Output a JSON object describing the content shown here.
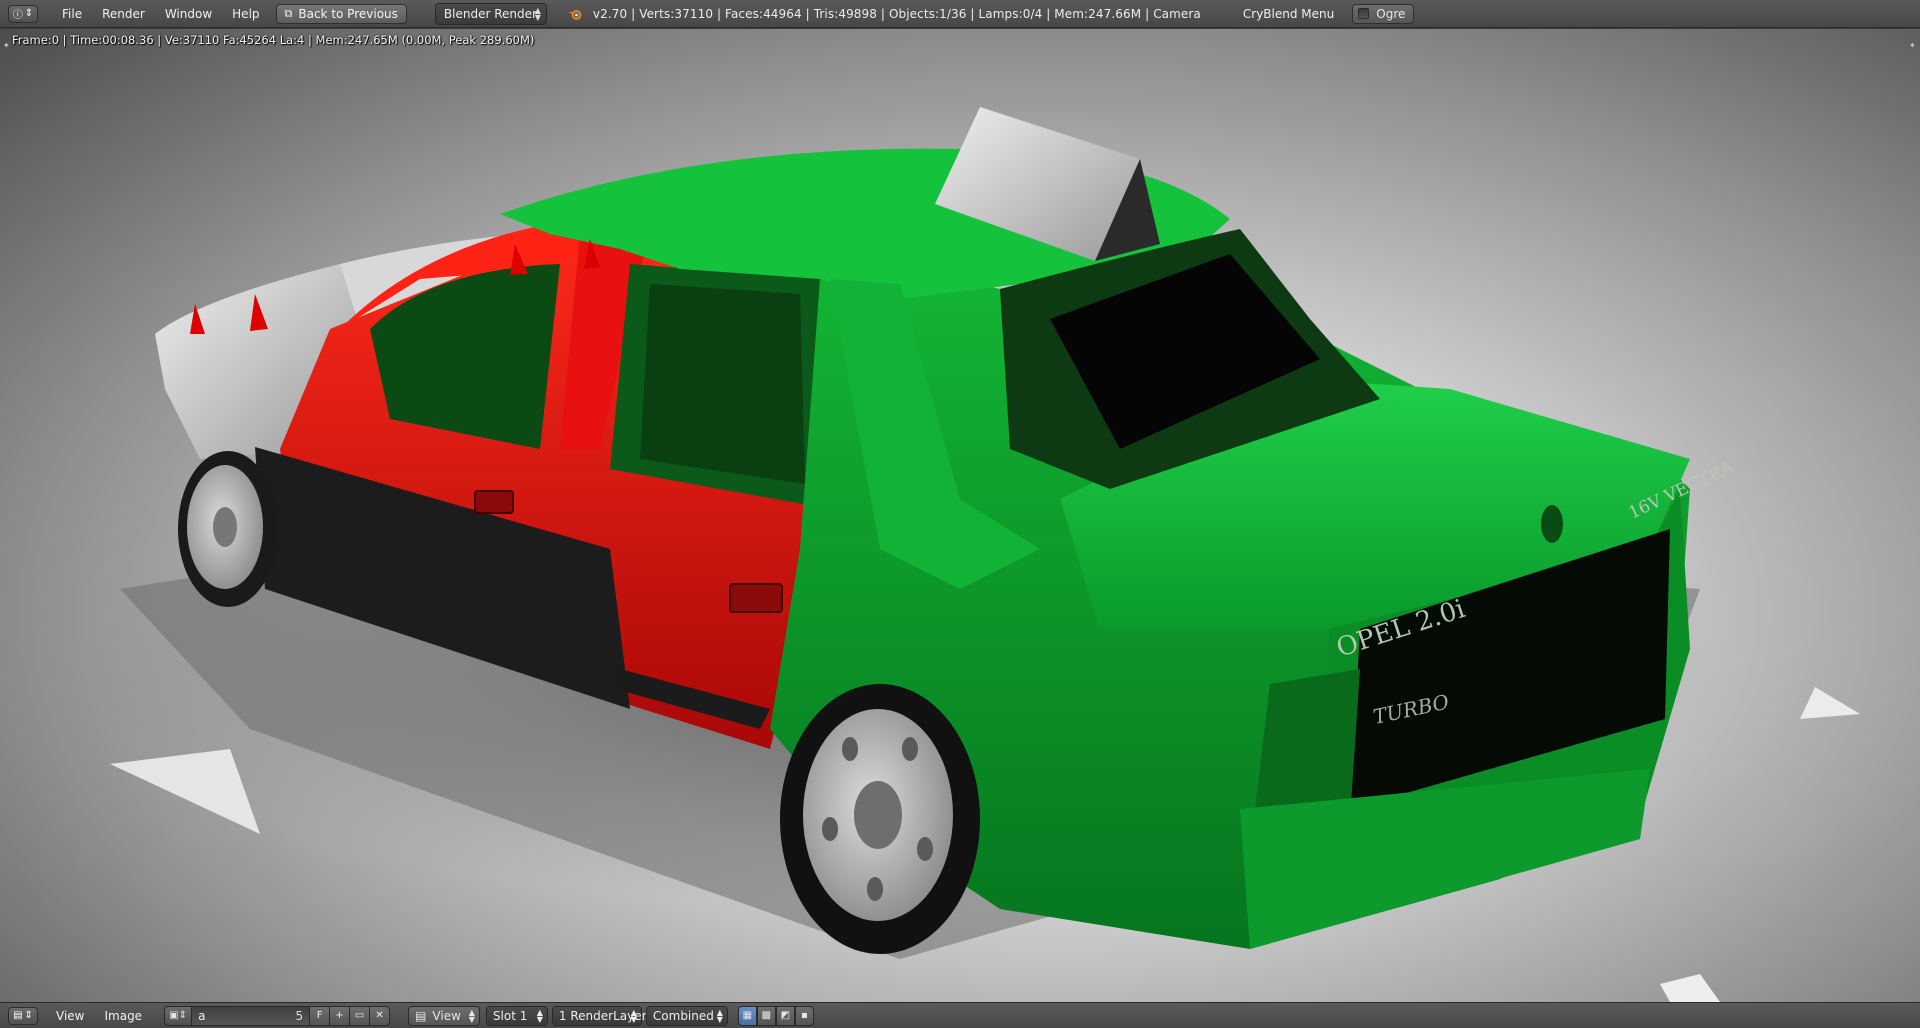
{
  "topbar": {
    "editor_icon": "info-icon",
    "menus": [
      "File",
      "Render",
      "Window",
      "Help"
    ],
    "back_button": "Back to Previous",
    "engine": "Blender Render",
    "stats": "v2.70 | Verts:37110 | Faces:44964 | Tris:49898 | Objects:1/36 | Lamps:0/4 | Mem:247.66M | Camera",
    "cryblend_menu": "CryBlend Menu",
    "ogre_label": "Ogre",
    "ogre_checked": false
  },
  "viewport": {
    "render_info": "Frame:0 | Time:00:08.36 | Ve:37110 Fa:45264 La:4 | Mem:247.65M (0.00M, Peak 289.60M)",
    "car_text": {
      "badge_opel": "OPEL 2.0i",
      "badge_turbo": "TURBO",
      "badge_model": "16V VECTRA"
    }
  },
  "bottombar": {
    "editor_icon": "image-editor-icon",
    "menus": [
      "View",
      "Image"
    ],
    "image_name": "a",
    "image_users": "5",
    "fake_user": "F",
    "view_label": "View",
    "slot": "Slot 1",
    "render_layer": "1 RenderLayer",
    "pass": "Combined"
  },
  "colors": {
    "car_green": "#12c03a",
    "car_red": "#d90f0f",
    "car_white": "#e8e8e8",
    "header_bg": "#505050"
  }
}
